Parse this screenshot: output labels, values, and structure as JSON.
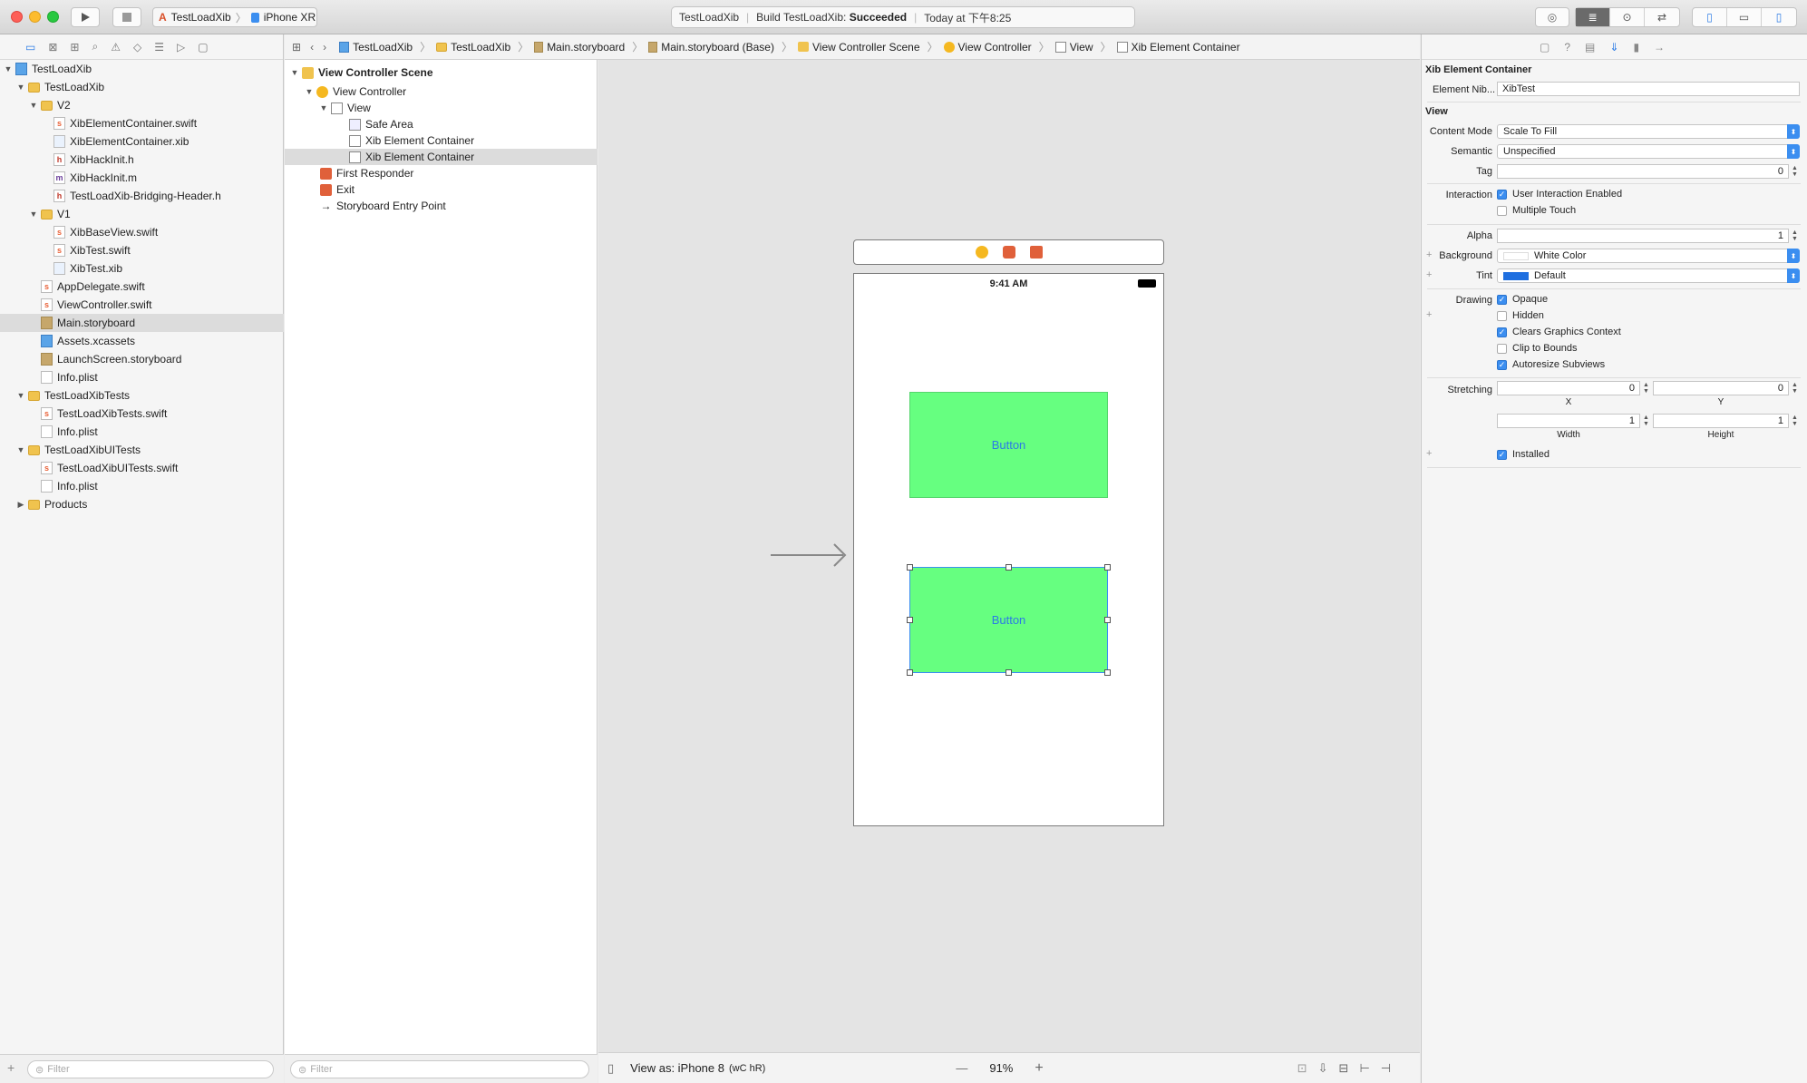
{
  "toolbar": {
    "scheme_target": "TestLoadXib",
    "scheme_device": "iPhone XR",
    "status_project": "TestLoadXib",
    "status_build_prefix": "Build TestLoadXib:",
    "status_build_result": "Succeeded",
    "status_time": "Today at 下午8:25"
  },
  "navigator": {
    "items": [
      {
        "label": "TestLoadXib",
        "icon": "project-icon"
      },
      {
        "label": "TestLoadXib",
        "icon": "folder-icon"
      },
      {
        "label": "V2",
        "icon": "folder-icon"
      },
      {
        "label": "XibElementContainer.swift",
        "icon": "swift-file-icon"
      },
      {
        "label": "XibElementContainer.xib",
        "icon": "xib-file-icon"
      },
      {
        "label": "XibHackInit.h",
        "icon": "header-file-icon"
      },
      {
        "label": "XibHackInit.m",
        "icon": "objc-file-icon"
      },
      {
        "label": "TestLoadXib-Bridging-Header.h",
        "icon": "header-file-icon"
      },
      {
        "label": "V1",
        "icon": "folder-icon"
      },
      {
        "label": "XibBaseView.swift",
        "icon": "swift-file-icon"
      },
      {
        "label": "XibTest.swift",
        "icon": "swift-file-icon"
      },
      {
        "label": "XibTest.xib",
        "icon": "xib-file-icon"
      },
      {
        "label": "AppDelegate.swift",
        "icon": "swift-file-icon"
      },
      {
        "label": "ViewController.swift",
        "icon": "swift-file-icon"
      },
      {
        "label": "Main.storyboard",
        "icon": "storyboard-file-icon"
      },
      {
        "label": "Assets.xcassets",
        "icon": "assets-icon"
      },
      {
        "label": "LaunchScreen.storyboard",
        "icon": "storyboard-file-icon"
      },
      {
        "label": "Info.plist",
        "icon": "plist-file-icon"
      },
      {
        "label": "TestLoadXibTests",
        "icon": "folder-icon"
      },
      {
        "label": "TestLoadXibTests.swift",
        "icon": "swift-file-icon"
      },
      {
        "label": "Info.plist",
        "icon": "plist-file-icon"
      },
      {
        "label": "TestLoadXibUITests",
        "icon": "folder-icon"
      },
      {
        "label": "TestLoadXibUITests.swift",
        "icon": "swift-file-icon"
      },
      {
        "label": "Info.plist",
        "icon": "plist-file-icon"
      },
      {
        "label": "Products",
        "icon": "folder-icon"
      }
    ],
    "filter_placeholder": "Filter"
  },
  "jumpbar": {
    "crumbs": [
      "TestLoadXib",
      "TestLoadXib",
      "Main.storyboard",
      "Main.storyboard (Base)",
      "View Controller Scene",
      "View Controller",
      "View",
      "Xib Element Container"
    ]
  },
  "outline": {
    "items": [
      "View Controller Scene",
      "View Controller",
      "View",
      "Safe Area",
      "Xib Element Container",
      "Xib Element Container",
      "First Responder",
      "Exit",
      "Storyboard Entry Point"
    ],
    "filter_placeholder": "Filter"
  },
  "canvas": {
    "status_time": "9:41 AM",
    "button1_label": "Button",
    "button2_label": "Button",
    "view_as": "View as: iPhone 8",
    "size_class": "(wC hR)",
    "zoom": "91%",
    "zoom_minus": "—",
    "zoom_plus": "+"
  },
  "inspector": {
    "section_title": "Xib Element Container",
    "element_nib_label": "Element Nib...",
    "element_nib_value": "XibTest",
    "view_header": "View",
    "content_mode_label": "Content Mode",
    "content_mode_value": "Scale To Fill",
    "semantic_label": "Semantic",
    "semantic_value": "Unspecified",
    "tag_label": "Tag",
    "tag_value": "0",
    "interaction_label": "Interaction",
    "user_interaction": "User Interaction Enabled",
    "multiple_touch": "Multiple Touch",
    "alpha_label": "Alpha",
    "alpha_value": "1",
    "background_label": "Background",
    "background_value": "White Color",
    "tint_label": "Tint",
    "tint_value": "Default",
    "drawing_label": "Drawing",
    "opaque": "Opaque",
    "hidden": "Hidden",
    "clears_graphics": "Clears Graphics Context",
    "clip_to_bounds": "Clip to Bounds",
    "autoresize_subviews": "Autoresize Subviews",
    "stretching_label": "Stretching",
    "stretch_x": "0",
    "stretch_y": "0",
    "x_label": "X",
    "y_label": "Y",
    "stretch_w": "1",
    "stretch_h": "1",
    "width_label": "Width",
    "height_label": "Height",
    "installed": "Installed",
    "tint_color": "#1f6fe0"
  }
}
